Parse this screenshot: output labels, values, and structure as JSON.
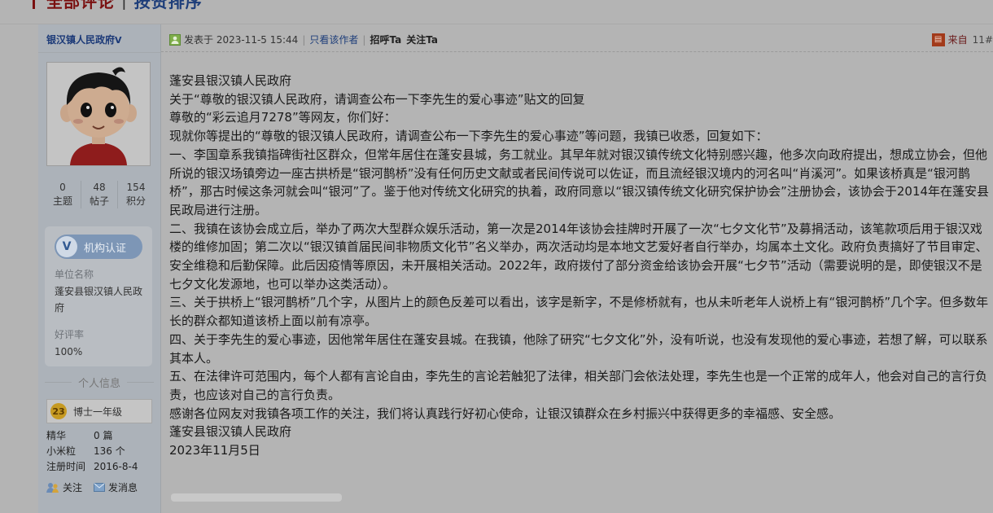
{
  "heading": {
    "all_comments": "全部评论",
    "sort_label": "按赞排序"
  },
  "author": {
    "name": "银汉镇人民政府",
    "verified_mark": "V",
    "stats": [
      {
        "value": "0",
        "label": "主题"
      },
      {
        "value": "48",
        "label": "帖子"
      },
      {
        "value": "154",
        "label": "积分"
      }
    ],
    "cert_label": "机构认证",
    "unit_name_label": "单位名称",
    "unit_name_value": "蓬安县银汉镇人民政府",
    "rating_label": "好评率",
    "rating_value": "100%",
    "section_title": "个人信息",
    "level_num": "23",
    "level_name": "博士一年级",
    "info": [
      {
        "key": "精华",
        "value": "0 篇"
      },
      {
        "key": "小米粒",
        "value": "136 个"
      },
      {
        "key": "注册时间",
        "value": "2016-8-4"
      }
    ],
    "follow_label": "关注",
    "message_label": "发消息"
  },
  "post_header": {
    "posted_at": "发表于 2023-11-5 15:44",
    "separator": "|",
    "only_author": "只看该作者",
    "greet": "招呼Ta",
    "follow": "关注Ta",
    "from_label": "来自",
    "floor": "11#"
  },
  "content": [
    "蓬安县银汉镇人民政府",
    "关于“尊敬的银汉镇人民政府，请调查公布一下李先生的爱心事迹”贴文的回复",
    "尊敬的“彩云追月7278”等网友，你们好：",
    "现就你等提出的“尊敬的银汉镇人民政府，请调查公布一下李先生的爱心事迹”等问题，我镇已收悉，回复如下：",
    "一、李国章系我镇指碑街社区群众，但常年居住在蓬安县城，务工就业。其早年就对银汉镇传统文化特别感兴趣，他多次向政府提出，想成立协会，但他所说的银汉场镇旁边一座古拱桥是“银河鹊桥”没有任何历史文献或者民间传说可以佐证，而且流经银汉境内的河名叫“肖溪河”。如果该桥真是“银河鹊桥”，那古时候这条河就会叫“银河”了。鉴于他对传统文化研究的执着，政府同意以“银汉镇传统文化研究保护协会”注册协会，该协会于2014年在蓬安县民政局进行注册。",
    "二、我镇在该协会成立后，举办了两次大型群众娱乐活动，第一次是2014年该协会挂牌时开展了一次“七夕文化节”及募捐活动，该笔款项后用于银汉戏楼的维修加固；第二次以“银汉镇首届民间非物质文化节”名义举办，两次活动均是本地文艺爱好者自行举办，均属本土文化。政府负责搞好了节目审定、安全维稳和后勤保障。此后因疫情等原因，未开展相关活动。2022年，政府拨付了部分资金给该协会开展“七夕节”活动（需要说明的是，即使银汉不是七夕文化发源地，也可以举办这类活动）。",
    "三、关于拱桥上“银河鹊桥”几个字，从图片上的颜色反差可以看出，该字是新字，不是修桥就有，也从未听老年人说桥上有“银河鹊桥”几个字。但多数年长的群众都知道该桥上面以前有凉亭。",
    "四、关于李先生的爱心事迹，因他常年居住在蓬安县城。在我镇，他除了研究“七夕文化”外，没有听说，也没有发现他的爱心事迹，若想了解，可以联系其本人。",
    "五、在法律许可范围内，每个人都有言论自由，李先生的言论若触犯了法律，相关部门会依法处理，李先生也是一个正常的成年人，他会对自己的言行负责，也应该对自己的言行负责。",
    "感谢各位网友对我镇各项工作的关注，我们将认真践行好初心使命，让银汉镇群众在乡村振兴中获得更多的幸福感、安全感。",
    "蓬安县银汉镇人民政府",
    "2023年11月5日"
  ]
}
